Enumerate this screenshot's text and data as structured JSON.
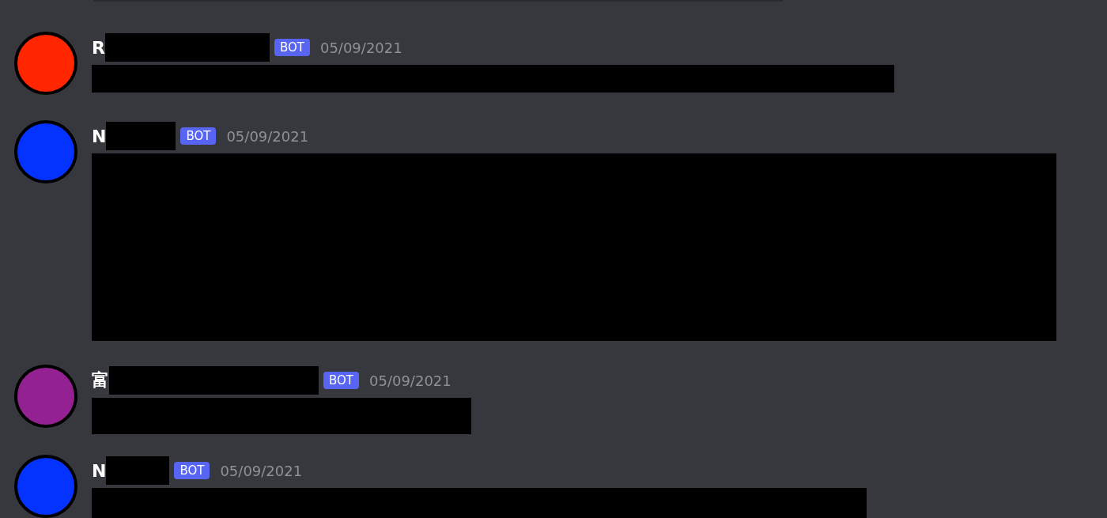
{
  "messages": [
    {
      "author": "R",
      "color": "#ff2600",
      "badge": "BOT",
      "timestamp": "05/09/2021"
    },
    {
      "author": "N",
      "color": "#0433ff",
      "badge": "BOT",
      "timestamp": "05/09/2021"
    },
    {
      "author": "富",
      "color": "#942192",
      "badge": "BOT",
      "timestamp": "05/09/2021"
    },
    {
      "author": "N",
      "color": "#0433ff",
      "badge": "BOT",
      "timestamp": "05/09/2021"
    }
  ]
}
